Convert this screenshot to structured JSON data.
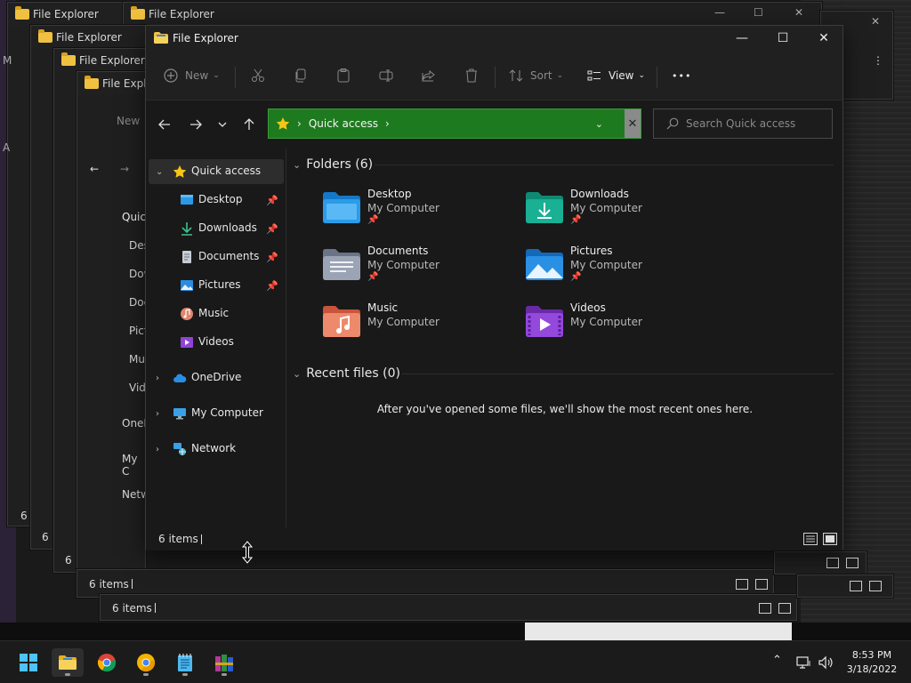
{
  "window": {
    "title": "File Explorer",
    "minimize_glyph": "—",
    "maximize_glyph": "☐",
    "close_glyph": "✕"
  },
  "toolbar": {
    "new_label": "New",
    "sort_label": "Sort",
    "view_label": "View",
    "more_glyph": "•••"
  },
  "address": {
    "segment": "Quick access",
    "placeholder": "Search Quick access"
  },
  "sidebar": {
    "quick_access": "Quick access",
    "items": [
      {
        "label": "Desktop",
        "pinned": true
      },
      {
        "label": "Downloads",
        "pinned": true
      },
      {
        "label": "Documents",
        "pinned": true
      },
      {
        "label": "Pictures",
        "pinned": true
      },
      {
        "label": "Music",
        "pinned": false
      },
      {
        "label": "Videos",
        "pinned": false
      }
    ],
    "onedrive": "OneDrive",
    "my_computer": "My Computer",
    "network": "Network"
  },
  "main": {
    "folders_header": "Folders (6)",
    "folders": [
      {
        "name": "Desktop",
        "location": "My Computer",
        "pinned": true,
        "color": "#1e90e0"
      },
      {
        "name": "Downloads",
        "location": "My Computer",
        "pinned": true,
        "color": "#17a589"
      },
      {
        "name": "Documents",
        "location": "My Computer",
        "pinned": true,
        "color": "#8a96a8"
      },
      {
        "name": "Pictures",
        "location": "My Computer",
        "pinned": true,
        "color": "#1f8fe0"
      },
      {
        "name": "Music",
        "location": "My Computer",
        "pinned": false,
        "color": "#e8735a"
      },
      {
        "name": "Videos",
        "location": "My Computer",
        "pinned": false,
        "color": "#8a3fd1"
      }
    ],
    "recent_header": "Recent files (0)",
    "recent_empty": "After you've opened some files, we'll show the most recent ones here."
  },
  "status": {
    "count": "6 items"
  },
  "ghosts": {
    "title_1": "File Explorer",
    "title_2": "File Explorer",
    "title_3": "File Explorer",
    "title_4": "File Explorer",
    "title_5": "File Explorer",
    "title_5_cut": "File Explo",
    "side_quick_cut": "Quic",
    "side_des": "Des",
    "side_dow": "Dow",
    "side_doc": "Doc",
    "side_pict": "Pict",
    "side_mu": "Mu",
    "side_vide": "Vide",
    "side_onedrive_cut": "OneD",
    "side_mycomp_cut": "My C",
    "side_network_cut": "Netw",
    "new_label": "New",
    "status_a": "6 items",
    "status_b": "6 items",
    "status_c": "6 items",
    "status_d": "6 i",
    "status_e": "6 i",
    "status_f": "6 i",
    "edge_glyph_a": "M",
    "edge_glyph_b": "A"
  },
  "clock": {
    "time": "8:53 PM",
    "date": "3/18/2022"
  },
  "colors": {
    "address_bg": "#1e7a1e",
    "accent_folder": "#f0c040"
  }
}
